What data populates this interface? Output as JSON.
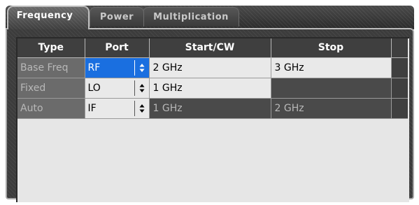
{
  "tabs": {
    "active": "Frequency",
    "power": "Power",
    "multiplication": "Multiplication"
  },
  "table": {
    "headers": [
      "Type",
      "Port",
      "Start/CW",
      "Stop"
    ],
    "rows": [
      {
        "type": "Base Freq",
        "port": "RF",
        "start": "2 GHz",
        "stop": "3 GHz"
      },
      {
        "type": "Fixed",
        "port": "LO",
        "start": "1 GHz",
        "stop": ""
      },
      {
        "type": "Auto",
        "port": "IF",
        "start": "1 GHz",
        "stop": "2 GHz"
      }
    ]
  },
  "icons": {
    "spinner": "up-down-arrows-icon"
  },
  "colors": {
    "selection": "#1a6fe0",
    "panel": "#3c3c3c",
    "grid_background": "#e6e6e6"
  }
}
